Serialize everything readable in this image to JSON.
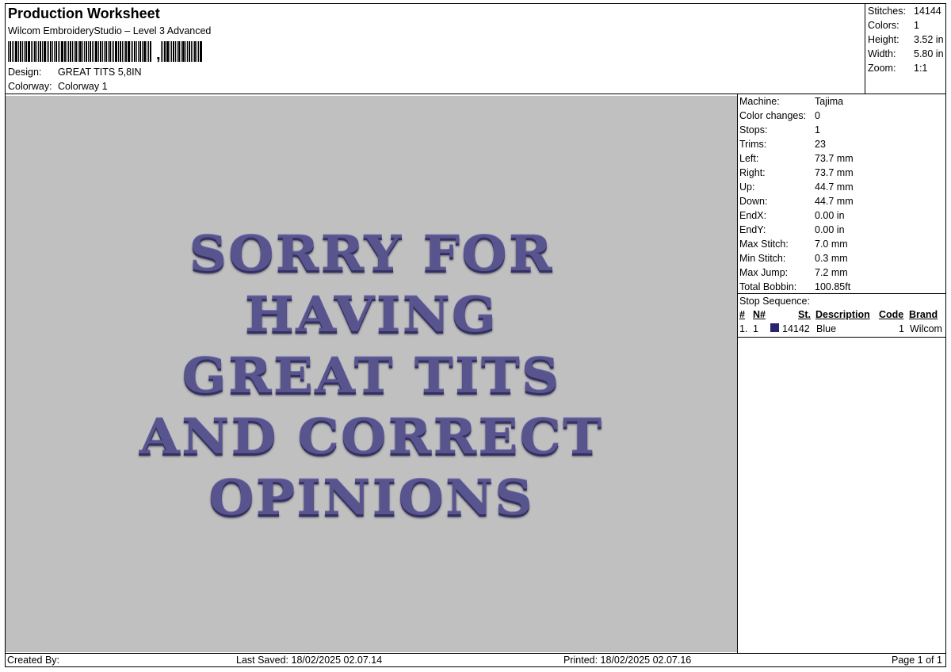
{
  "header": {
    "title": "Production Worksheet",
    "subtitle": "Wilcom EmbroideryStudio – Level 3 Advanced",
    "barcode_suffix": ",",
    "design_label": "Design:",
    "design_value": "GREAT TITS 5,8IN",
    "colorway_label": "Colorway:",
    "colorway_value": "Colorway 1"
  },
  "summary": [
    {
      "label": "Stitches:",
      "value": "14144"
    },
    {
      "label": "Colors:",
      "value": "1"
    },
    {
      "label": "Height:",
      "value": "3.52 in"
    },
    {
      "label": "Width:",
      "value": "5.80 in"
    },
    {
      "label": "Zoom:",
      "value": "1:1"
    }
  ],
  "design_text": [
    "SORRY FOR",
    "HAVING",
    "GREAT TITS",
    "AND CORRECT",
    "OPINIONS"
  ],
  "details": [
    {
      "label": "Machine:",
      "value": "Tajima"
    },
    {
      "label": "Color changes:",
      "value": "0"
    },
    {
      "label": "Stops:",
      "value": "1"
    },
    {
      "label": "Trims:",
      "value": "23"
    },
    {
      "label": "Left:",
      "value": "73.7 mm"
    },
    {
      "label": "Right:",
      "value": "73.7 mm"
    },
    {
      "label": "Up:",
      "value": "44.7 mm"
    },
    {
      "label": "Down:",
      "value": "44.7 mm"
    },
    {
      "label": "EndX:",
      "value": "0.00 in"
    },
    {
      "label": "EndY:",
      "value": "0.00 in"
    },
    {
      "label": "Max Stitch:",
      "value": "7.0 mm"
    },
    {
      "label": "Min Stitch:",
      "value": "0.3 mm"
    },
    {
      "label": "Max Jump:",
      "value": "7.2 mm"
    },
    {
      "label": "Total Bobbin:",
      "value": "100.85ft"
    }
  ],
  "stop_sequence": {
    "title": "Stop Sequence:",
    "columns": {
      "num": "#",
      "n": "N#",
      "st": "St.",
      "description": "Description",
      "code": "Code",
      "brand": "Brand"
    },
    "rows": [
      {
        "num": "1.",
        "n": "1",
        "swatch_color": "#2a2470",
        "st": "14142",
        "description": "Blue",
        "code": "1",
        "brand": "Wilcom"
      }
    ]
  },
  "footer": {
    "created_by": "Created By:",
    "last_saved": "Last Saved: 18/02/2025 02.07.14",
    "printed": "Printed: 18/02/2025 02.07.16",
    "page": "Page 1 of 1"
  },
  "colors": {
    "thread": "#58548e",
    "canvas": "#c0c0c0"
  }
}
